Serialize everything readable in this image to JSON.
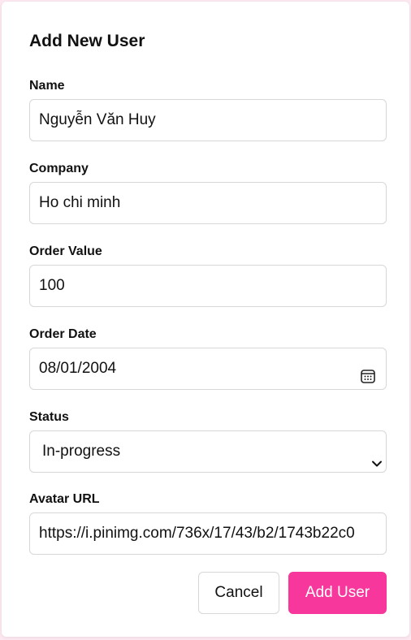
{
  "form": {
    "title": "Add New User",
    "fields": {
      "name": {
        "label": "Name",
        "value": "Nguyễn Văn Huy"
      },
      "company": {
        "label": "Company",
        "value": "Ho chi minh"
      },
      "order_value": {
        "label": "Order Value",
        "value": "100"
      },
      "order_date": {
        "label": "Order Date",
        "value": "08/01/2004",
        "icon": "calendar-icon"
      },
      "status": {
        "label": "Status",
        "value": "In-progress",
        "icon": "chevron-down-icon"
      },
      "avatar_url": {
        "label": "Avatar URL",
        "value": "https://i.pinimg.com/736x/17/43/b2/1743b22c0"
      }
    },
    "buttons": {
      "cancel": "Cancel",
      "add_user": "Add User"
    }
  },
  "colors": {
    "accent": "#f7379b",
    "background": "#fde7f0",
    "border": "#d7d7d7"
  }
}
